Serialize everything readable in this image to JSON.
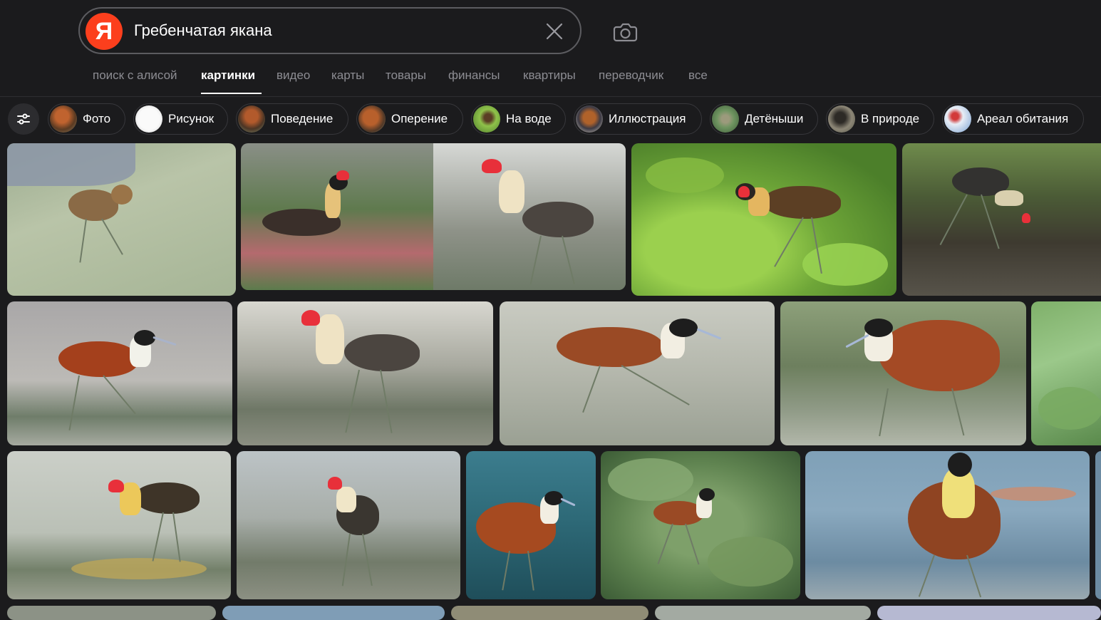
{
  "search": {
    "query": "Гребенчатая якана",
    "logo_letter": "Я"
  },
  "nav": {
    "items": [
      {
        "label": "поиск с алисой",
        "active": false
      },
      {
        "label": "картинки",
        "active": true
      },
      {
        "label": "видео",
        "active": false
      },
      {
        "label": "карты",
        "active": false
      },
      {
        "label": "товары",
        "active": false
      },
      {
        "label": "финансы",
        "active": false
      },
      {
        "label": "квартиры",
        "active": false
      },
      {
        "label": "переводчик",
        "active": false
      },
      {
        "label": "все",
        "active": false
      }
    ]
  },
  "chips": [
    {
      "label": "Фото",
      "thumb_color": "#8a4a2a"
    },
    {
      "label": "Рисунок",
      "thumb_color": "#e6e6e6"
    },
    {
      "label": "Поведение",
      "thumb_color": "#7a5238"
    },
    {
      "label": "Оперение",
      "thumb_color": "#8c5a34"
    },
    {
      "label": "На воде",
      "thumb_color": "#6d9a3a"
    },
    {
      "label": "Иллюстрация",
      "thumb_color": "#a86a3c"
    },
    {
      "label": "Детёныши",
      "thumb_color": "#5f8050"
    },
    {
      "label": "В природе",
      "thumb_color": "#66645a"
    },
    {
      "label": "Ареал обитания",
      "thumb_color": "#c9d8ec"
    }
  ],
  "colors": {
    "background": "#1b1b1d",
    "accent_logo": "#fc3f1d",
    "nav_inactive": "#8d8d93"
  }
}
